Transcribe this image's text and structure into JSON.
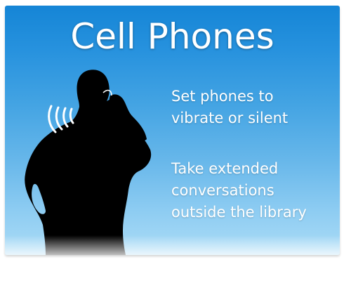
{
  "sign": {
    "title": "Cell Phones",
    "messages": [
      {
        "lines": [
          "Set phones to",
          "vibrate or silent"
        ]
      },
      {
        "lines": [
          "Take extended",
          "conversations",
          "outside the library"
        ]
      }
    ]
  },
  "colors": {
    "background_top": "#1585d6",
    "background_bottom": "#acdcf6",
    "text": "#ffffff",
    "silhouette": "#000000"
  },
  "icons": {
    "figure": "person-on-phone-silhouette",
    "sound_waves": "ringing-waves-icon"
  }
}
